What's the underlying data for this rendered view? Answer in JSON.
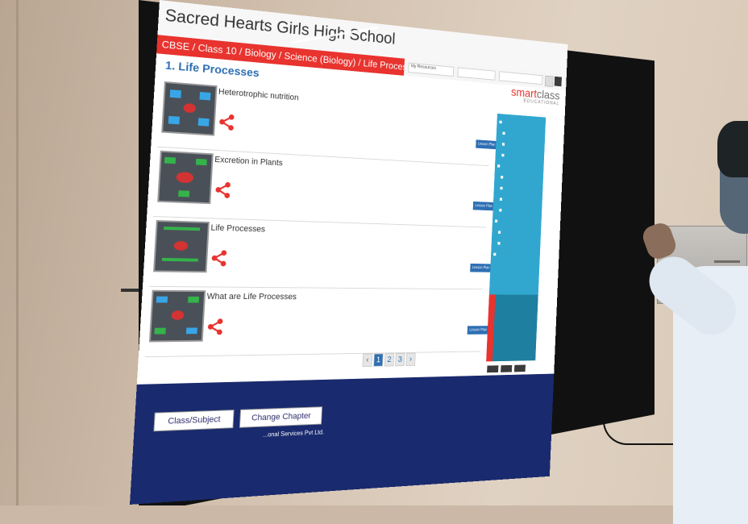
{
  "screen": {
    "school_name": "Sacred Hearts Girls High School",
    "breadcrumb": "CBSE / Class 10 / Biology / Science (Biology) / Life Processes",
    "chapter_title": "1. Life Processes",
    "toolbar": {
      "resource_select": "My Resources",
      "select_2": "",
      "select_3": ""
    },
    "brand": {
      "name_part1": "smart",
      "name_part2": "class",
      "tagline": "EDUCATIONAL"
    },
    "items": [
      {
        "title": "Heterotrophic nutrition",
        "action_label": "Lesson Plan"
      },
      {
        "title": "Excretion in Plants",
        "action_label": "Lesson Plan"
      },
      {
        "title": "Life Processes",
        "action_label": "Lesson Plan"
      },
      {
        "title": "What are Life Processes",
        "action_label": "Lesson Plan"
      }
    ],
    "pagination": {
      "prev": "‹",
      "pages": [
        "1",
        "2",
        "3"
      ],
      "current": "1",
      "next": "›"
    },
    "sidebar": {
      "items": [],
      "buttons": [
        "",
        "",
        ""
      ]
    },
    "footer": {
      "buttons": [
        "Class/Subject",
        "Change Chapter"
      ],
      "copyright": "...onal Services Pvt Ltd."
    }
  },
  "colors": {
    "accent_red": "#e8332e",
    "accent_blue": "#2d6fb3",
    "sidebar_blue": "#31a7cf",
    "footer_navy": "#1a2a6e"
  },
  "icons": [
    "share-icon",
    "chevron-left-icon",
    "chevron-right-icon"
  ]
}
